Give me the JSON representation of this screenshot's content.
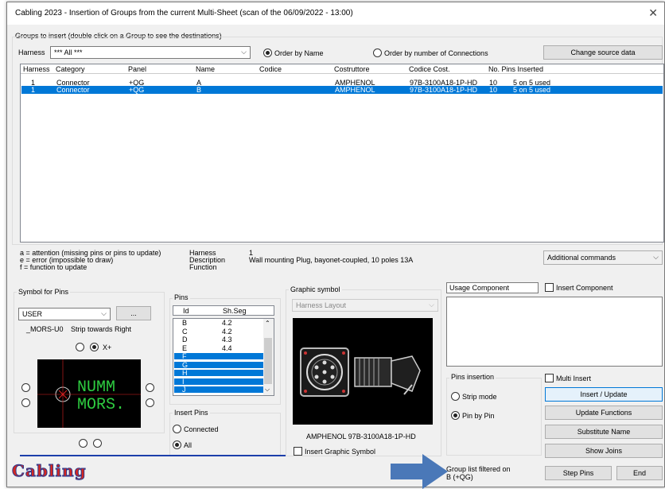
{
  "window": {
    "title": "Cabling 2023 - Insertion of Groups from the current Multi-Sheet  (scan of the 06/09/2022 - 13:00)"
  },
  "groups_hint": "Groups to insert  (double click on a Group to see the destinations)",
  "harness_filter": {
    "label": "Harness",
    "value": "*** All ***"
  },
  "order": {
    "by_name": "Order by Name",
    "by_connections": "Order by number of Connections",
    "selected": "by_name"
  },
  "change_source": "Change source data",
  "table": {
    "headers": [
      "Harness",
      "Category",
      "Panel",
      "Name",
      "Codice",
      "Costruttore",
      "Codice Cost.",
      "No. Pins Inserted"
    ],
    "rows": [
      {
        "harness": "1",
        "category": "Connector",
        "panel": "+QG",
        "name": "A",
        "codice": "",
        "costruttore": "AMPHENOL",
        "codice_cost": "97B-3100A18-1P-HD",
        "pins": "10",
        "inserted": "5 on 5 used",
        "selected": false
      },
      {
        "harness": "1",
        "category": "Connector",
        "panel": "+QG",
        "name": "B",
        "codice": "",
        "costruttore": "AMPHENOL",
        "codice_cost": "97B-3100A18-1P-HD",
        "pins": "10",
        "inserted": "5 on 5 used",
        "selected": true
      }
    ]
  },
  "legend": {
    "a": "a = attention (missing pins or pins to update)",
    "e": "e = error (impossible to draw)",
    "f": "f = function to update"
  },
  "details": {
    "harness_label": "Harness",
    "harness_value": "1",
    "description_label": "Description",
    "description_value": "Wall mounting Plug, bayonet-coupled, 10 poles 13A",
    "function_label": "Function",
    "function_value": ""
  },
  "additional_commands": "Additional commands",
  "symbol": {
    "group_label": "Symbol for Pins",
    "combo_value": "USER",
    "browse": "...",
    "name": "_MORS-U0",
    "strip": "Strip towards Right",
    "x_label": "X+",
    "preview_text_1": "NUMM",
    "preview_text_2": "MORS."
  },
  "pins": {
    "group_label": "Pins",
    "col_id": "Id",
    "col_seg": "Sh.Seg",
    "rows": [
      {
        "id": "B",
        "seg": "4.2",
        "sel": false
      },
      {
        "id": "C",
        "seg": "4.2",
        "sel": false
      },
      {
        "id": "D",
        "seg": "4.3",
        "sel": false
      },
      {
        "id": "E",
        "seg": "4.4",
        "sel": false
      },
      {
        "id": "F",
        "seg": "",
        "sel": true
      },
      {
        "id": "G",
        "seg": "",
        "sel": true
      },
      {
        "id": "H",
        "seg": "",
        "sel": true
      },
      {
        "id": "I",
        "seg": "",
        "sel": true
      },
      {
        "id": "J",
        "seg": "",
        "sel": true
      }
    ]
  },
  "insert_pins": {
    "label": "Insert Pins",
    "connected": "Connected",
    "all": "All",
    "selected": "all"
  },
  "graphic": {
    "label": "Graphic symbol",
    "combo": "Harness Layout",
    "caption": "AMPHENOL 97B-3100A18-1P-HD",
    "insert_graphic": "Insert Graphic Symbol"
  },
  "usage": {
    "label": "Usage Component",
    "insert_component": "Insert Component"
  },
  "pins_insertion": {
    "label": "Pins insertion",
    "strip": "Strip mode",
    "pin_by_pin": "Pin by Pin",
    "selected": "pin_by_pin"
  },
  "multi_insert": "Multi Insert",
  "buttons": {
    "insert_update": "Insert / Update",
    "update_functions": "Update Functions",
    "substitute_name": "Substitute Name",
    "show_joins": "Show Joins",
    "step_pins": "Step Pins",
    "end": "End"
  },
  "filter_status": {
    "line1": "Group list filtered on",
    "line2": "B (+QG)"
  },
  "logo": "Cabling",
  "colors": {
    "selection": "#0078d7",
    "logo": "#d7271f",
    "arrow": "#4a78b8",
    "preview_green": "#2ecc40",
    "preview_red": "#e02020"
  }
}
